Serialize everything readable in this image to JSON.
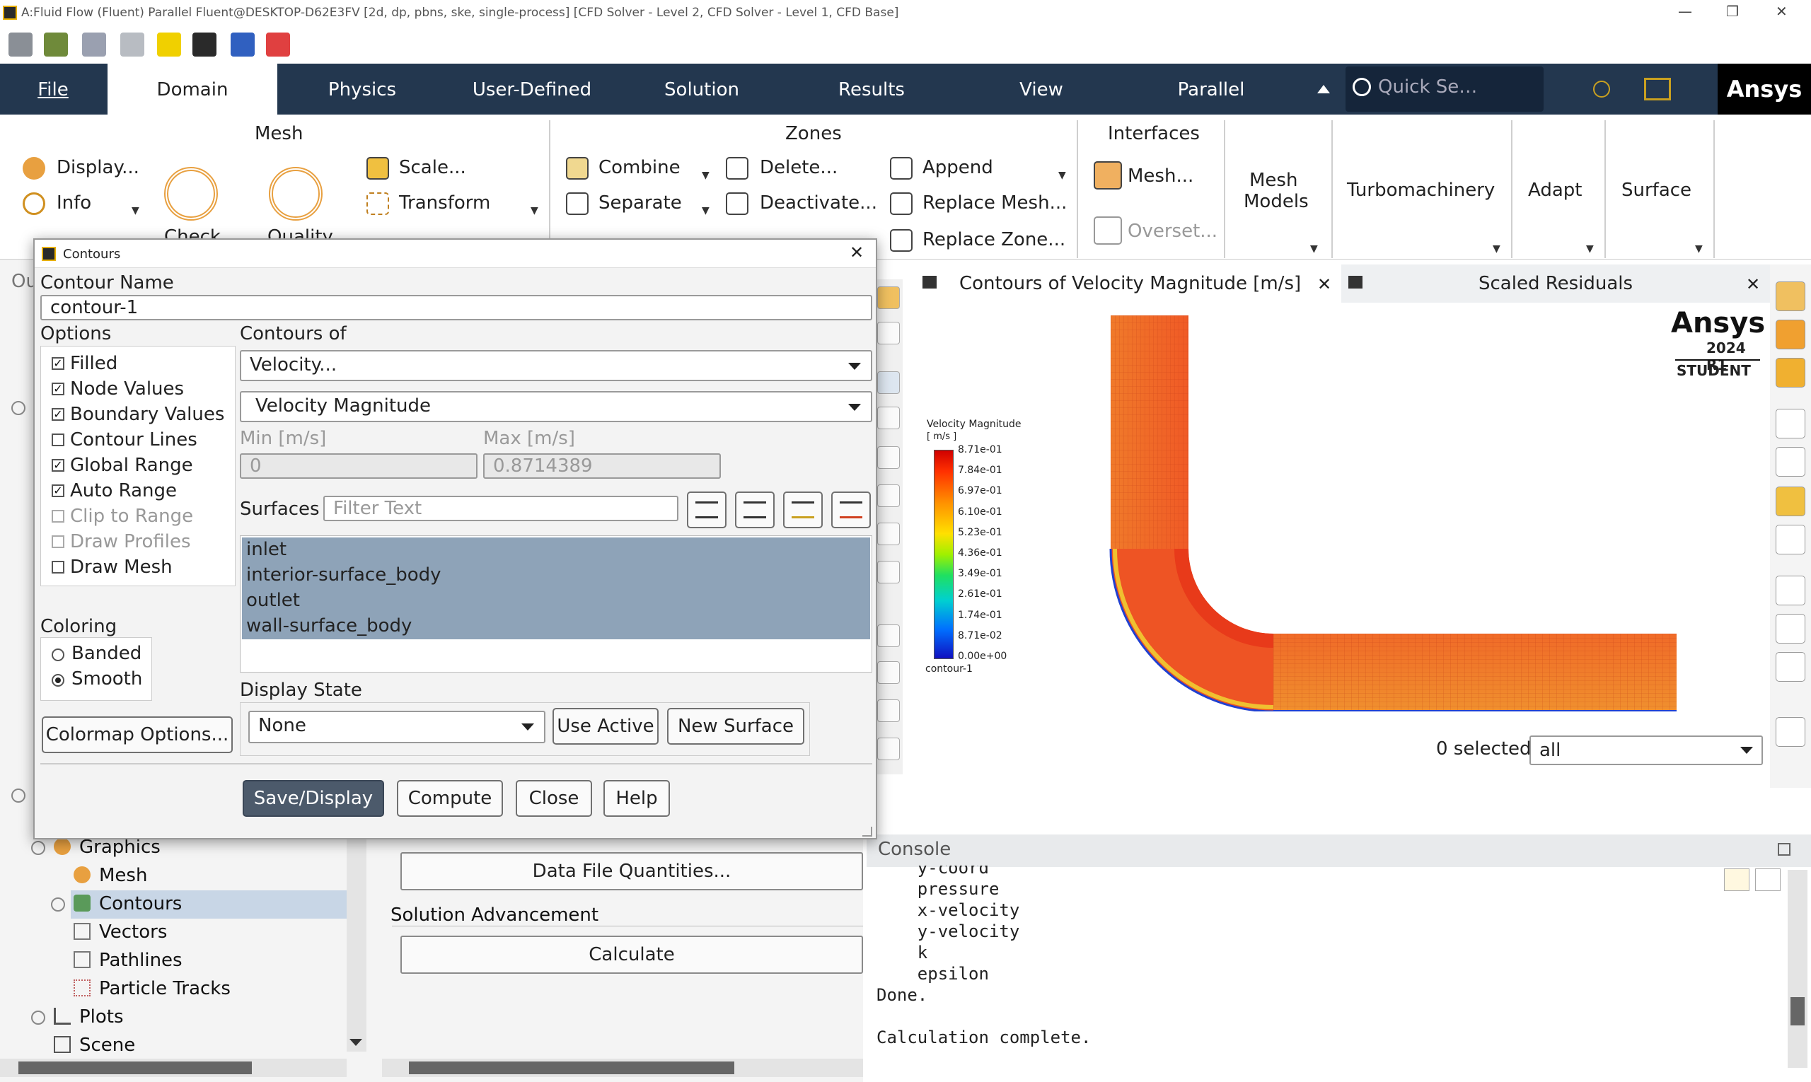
{
  "window": {
    "title": "A:Fluid Flow (Fluent) Parallel Fluent@DESKTOP-D62E3FV  [2d, dp, pbns, ske, single-process] [CFD Solver - Level 2, CFD Solver - Level 1, CFD Base]",
    "minimize": "—",
    "restore": "❐",
    "close": "✕"
  },
  "tabs": [
    {
      "label": "File"
    },
    {
      "label": "Domain"
    },
    {
      "label": "Physics"
    },
    {
      "label": "User-Defined"
    },
    {
      "label": "Solution"
    },
    {
      "label": "Results"
    },
    {
      "label": "View"
    },
    {
      "label": "Parallel"
    }
  ],
  "search": {
    "placeholder": "Quick Se…"
  },
  "brand": "Ansys",
  "ribbon": {
    "mesh_section": "Mesh",
    "display": "Display...",
    "info": "Info",
    "check": "Check",
    "quality": "Quality",
    "scale": "Scale...",
    "transform": "Transform",
    "zones_section": "Zones",
    "combine": "Combine",
    "separate": "Separate",
    "delete": "Delete...",
    "deactivate": "Deactivate...",
    "append": "Append",
    "replace_mesh": "Replace Mesh...",
    "replace_zone": "Replace Zone...",
    "interfaces_section": "Interfaces",
    "mesh_iface": "Mesh...",
    "overset": "Overset...",
    "mesh_models_1": "Mesh",
    "mesh_models_2": "Models",
    "turbomachinery": "Turbomachinery",
    "adapt": "Adapt",
    "surface": "Surface"
  },
  "dialog": {
    "title": "Contours",
    "contour_name_label": "Contour Name",
    "contour_name": "contour-1",
    "options_label": "Options",
    "options": [
      {
        "label": "Filled",
        "checked": "✓"
      },
      {
        "label": "Node Values",
        "checked": "✓"
      },
      {
        "label": "Boundary Values",
        "checked": "✓"
      },
      {
        "label": "Contour Lines",
        "checked": ""
      },
      {
        "label": "Global Range",
        "checked": "✓"
      },
      {
        "label": "Auto Range",
        "checked": "✓"
      },
      {
        "label": "Clip to Range",
        "checked": ""
      },
      {
        "label": "Draw Profiles",
        "checked": ""
      },
      {
        "label": "Draw Mesh",
        "checked": ""
      }
    ],
    "contours_of_label": "Contours of",
    "contours_of": "Velocity...",
    "contours_sub": "Velocity Magnitude",
    "min_label": "Min [m/s]",
    "max_label": "Max [m/s]",
    "min_value": "0",
    "max_value": "0.8714389",
    "surfaces_label": "Surfaces",
    "filter_placeholder": "Filter Text",
    "surfaces": [
      "inlet",
      "interior-surface_body",
      "outlet",
      "wall-surface_body"
    ],
    "coloring_label": "Coloring",
    "banded": "Banded",
    "smooth": "Smooth",
    "colormap_btn": "Colormap Options...",
    "display_state_label": "Display State",
    "display_state": "None",
    "use_active": "Use Active",
    "new_surface": "New Surface",
    "save_display": "Save/Display",
    "compute": "Compute",
    "close": "Close",
    "help": "Help"
  },
  "tree": {
    "outline_stub": "Ou",
    "graphics": "Graphics",
    "mesh": "Mesh",
    "contours": "Contours",
    "vectors": "Vectors",
    "pathlines": "Pathlines",
    "particle_tracks": "Particle Tracks",
    "plots": "Plots",
    "scene": "Scene"
  },
  "task": {
    "data_file": "Data File Quantities...",
    "solution_advancement": "Solution Advancement",
    "calculate": "Calculate"
  },
  "graphics": {
    "tab1": "Contours of Velocity Magnitude [m/s]",
    "tab2": "Scaled Residuals",
    "logo": "Ansys",
    "version": "2024 R1",
    "edition": "STUDENT",
    "legend_title": "Velocity Magnitude",
    "legend_unit": "[ m/s ]",
    "legend_ticks": [
      "8.71e-01",
      "7.84e-01",
      "6.97e-01",
      "6.10e-01",
      "5.23e-01",
      "4.36e-01",
      "3.49e-01",
      "2.61e-01",
      "1.74e-01",
      "8.71e-02",
      "0.00e+00"
    ],
    "legend_footer": "contour-1",
    "selected": "0 selected",
    "filter_all": "all",
    "colors": {
      "high": "#e83a1a",
      "mid": "#f08a30",
      "low": "#2040d0"
    }
  },
  "console": {
    "title": "Console",
    "lines": [
      "    y-coord",
      "    pressure",
      "    x-velocity",
      "    y-velocity",
      "    k",
      "    epsilon",
      "Done.",
      "",
      "Calculation complete."
    ]
  }
}
